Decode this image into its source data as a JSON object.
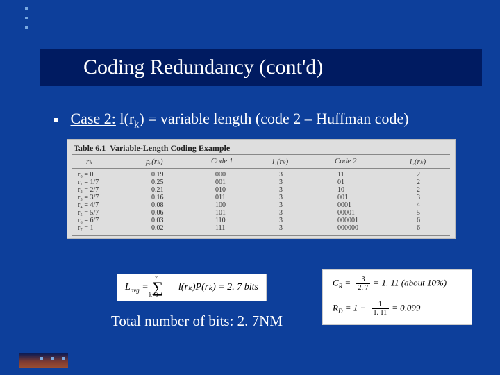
{
  "title": "Coding Redundancy (cont'd)",
  "bullet": {
    "case_label": "Case 2:",
    "rest": " l(r",
    "sub": "k",
    "rest2": ") = variable length (code 2 – Huffman code)"
  },
  "table": {
    "caption_number": "Table 6.1",
    "caption_title": "Variable-Length Coding Example",
    "headers": [
      "rₖ",
      "pᵣ(rₖ)",
      "Code 1",
      "l₁(rₖ)",
      "Code 2",
      "l₂(rₖ)"
    ],
    "rows": [
      {
        "rk": "r₀ = 0",
        "pr": "0.19",
        "c1": "000",
        "l1": "3",
        "c2": "11",
        "l2": "2"
      },
      {
        "rk": "r₁ = 1/7",
        "pr": "0.25",
        "c1": "001",
        "l1": "3",
        "c2": "01",
        "l2": "2"
      },
      {
        "rk": "r₂ = 2/7",
        "pr": "0.21",
        "c1": "010",
        "l1": "3",
        "c2": "10",
        "l2": "2"
      },
      {
        "rk": "r₃ = 3/7",
        "pr": "0.16",
        "c1": "011",
        "l1": "3",
        "c2": "001",
        "l2": "3"
      },
      {
        "rk": "r₄ = 4/7",
        "pr": "0.08",
        "c1": "100",
        "l1": "3",
        "c2": "0001",
        "l2": "4"
      },
      {
        "rk": "r₅ = 5/7",
        "pr": "0.06",
        "c1": "101",
        "l1": "3",
        "c2": "00001",
        "l2": "5"
      },
      {
        "rk": "r₆ = 6/7",
        "pr": "0.03",
        "c1": "110",
        "l1": "3",
        "c2": "000001",
        "l2": "6"
      },
      {
        "rk": "r₇ = 1",
        "pr": "0.02",
        "c1": "111",
        "l1": "3",
        "c2": "000000",
        "l2": "6"
      }
    ]
  },
  "eq_left": {
    "lsym": "L",
    "sub": "avg",
    "eq": " = ",
    "sum_upper": "7",
    "sum_lower": "k=0",
    "body": " l(rₖ)P(rₖ) = 2. 7 bits"
  },
  "eq_right": {
    "cr_sym": "C",
    "cr_sub": "R",
    "cr_eq": " = ",
    "cr_num": "3",
    "cr_den": "2. 7",
    "cr_val": "= 1. 11  (about 10%)",
    "rd_sym": "R",
    "rd_sub": "D",
    "rd_eq": " = 1 − ",
    "rd_num": "1",
    "rd_den": "1. 11",
    "rd_val": "= 0.099"
  },
  "total_bits": "Total number of bits: 2. 7NM",
  "chart_data": {
    "type": "table",
    "title": "Variable-Length Coding Example",
    "columns": [
      "r_k",
      "p_r(r_k)",
      "Code 1",
      "l1(r_k)",
      "Code 2",
      "l2(r_k)"
    ],
    "rows": [
      [
        "0",
        0.19,
        "000",
        3,
        "11",
        2
      ],
      [
        "1/7",
        0.25,
        "001",
        3,
        "01",
        2
      ],
      [
        "2/7",
        0.21,
        "010",
        3,
        "10",
        2
      ],
      [
        "3/7",
        0.16,
        "011",
        3,
        "001",
        3
      ],
      [
        "4/7",
        0.08,
        "100",
        3,
        "0001",
        4
      ],
      [
        "5/7",
        0.06,
        "101",
        3,
        "00001",
        5
      ],
      [
        "6/7",
        0.03,
        "110",
        3,
        "000001",
        6
      ],
      [
        "1",
        0.02,
        "111",
        3,
        "000000",
        6
      ]
    ]
  }
}
